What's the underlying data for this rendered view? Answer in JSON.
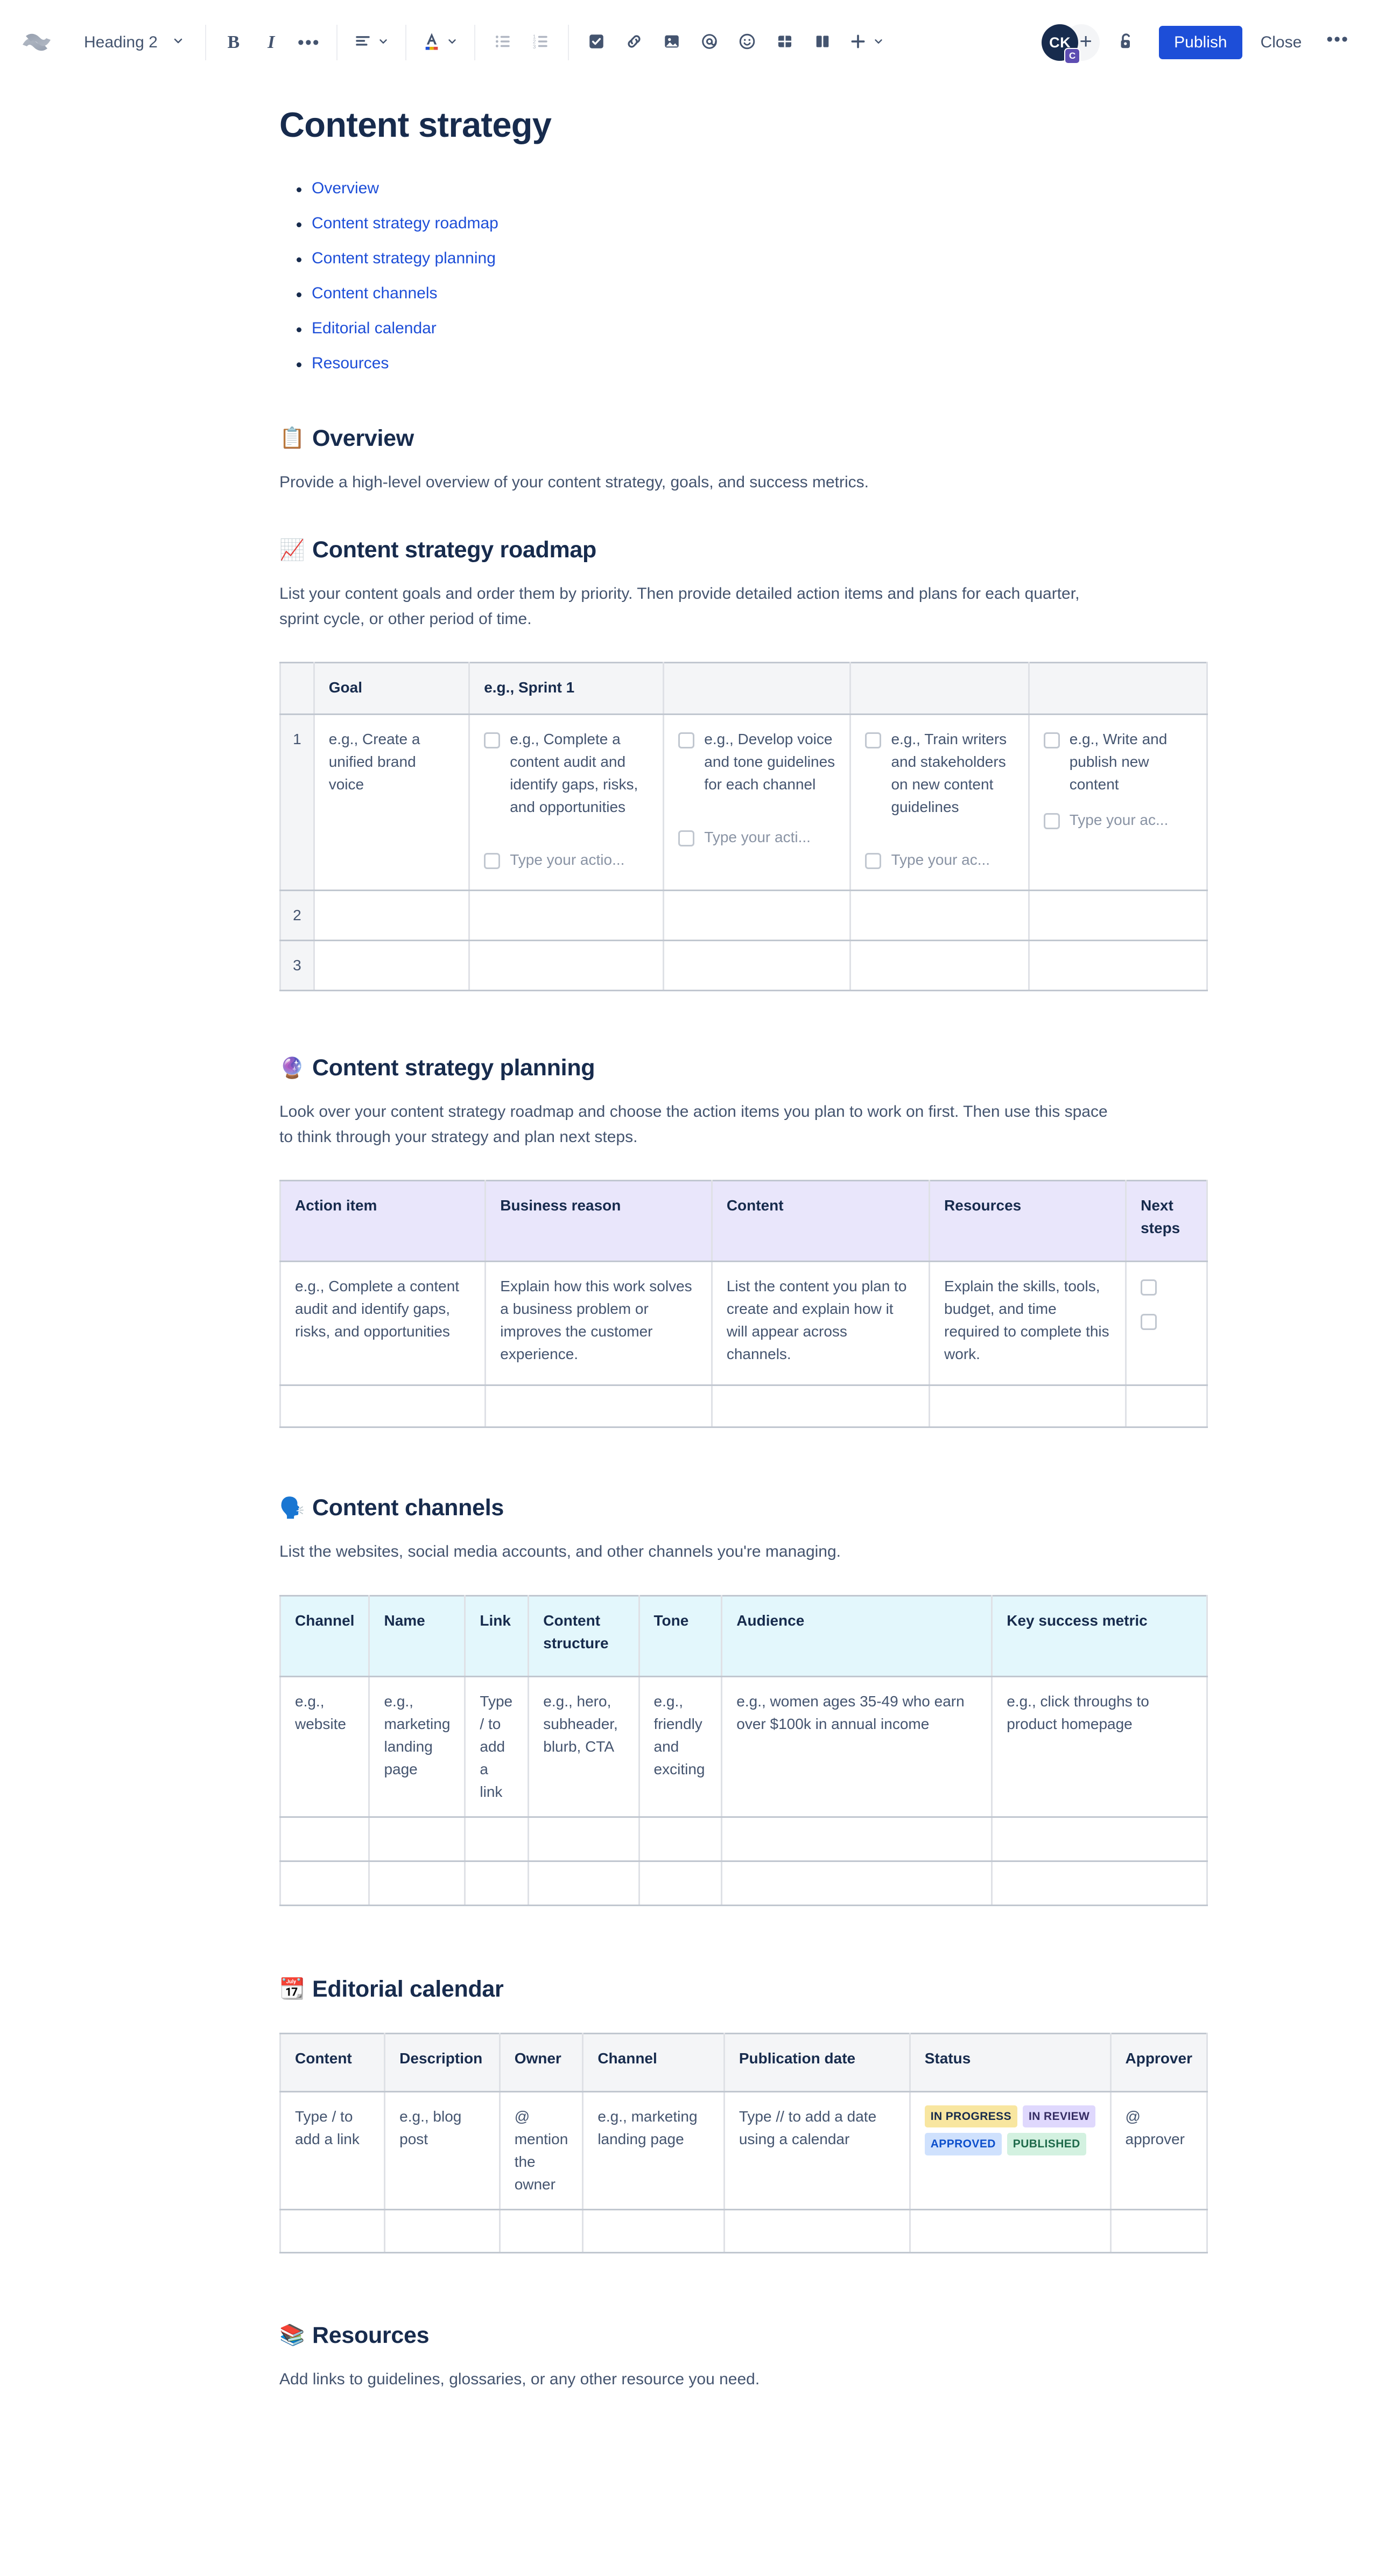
{
  "toolbar": {
    "logo_name": "confluence-logo",
    "style_select": {
      "label": "Heading 2"
    },
    "bold_label": "B",
    "italic_label": "I",
    "more_formatting_label": "•••",
    "avatar_initials": "CK",
    "avatar_badge": "C",
    "add_person_label": "+",
    "publish_label": "Publish",
    "close_label": "Close",
    "more_label": "•••",
    "accent_color": "#1D4ED8",
    "icons": [
      "text-style-dropdown",
      "bold-icon",
      "italic-icon",
      "more-formatting-icon",
      "text-align-icon",
      "text-color-icon",
      "bullet-list-icon",
      "numbered-list-icon",
      "task-list-icon",
      "link-icon",
      "image-icon",
      "mention-icon",
      "emoji-icon",
      "table-icon",
      "layout-icon",
      "insert-plus-icon",
      "lock-icon"
    ]
  },
  "document": {
    "title": "Content strategy",
    "toc": [
      {
        "label": "Overview"
      },
      {
        "label": "Content strategy roadmap"
      },
      {
        "label": "Content strategy planning"
      },
      {
        "label": "Content channels"
      },
      {
        "label": "Editorial calendar"
      },
      {
        "label": "Resources"
      }
    ],
    "sections": {
      "overview": {
        "emoji": "📋",
        "emoji_name": "clipboard-emoji",
        "heading": "Overview",
        "body": "Provide a high-level overview of your content strategy, goals, and success metrics."
      },
      "roadmap": {
        "emoji": "📈",
        "emoji_name": "chart-increasing-emoji",
        "heading": "Content strategy roadmap",
        "body": "List your content goals and order them by priority. Then provide detailed action items and plans for each quarter, sprint cycle, or other period of time.",
        "table": {
          "headers": [
            "",
            "Goal",
            "e.g., Sprint 1",
            "",
            "",
            ""
          ],
          "rows": [
            {
              "num": "1",
              "goal": "e.g., Create a unified brand voice",
              "cells": [
                {
                  "items": [
                    "e.g., Complete a content audit and identify gaps, risks, and opportunities"
                  ],
                  "placeholder": "Type your actio..."
                },
                {
                  "items": [
                    "e.g., Develop voice and tone guidelines for each channel"
                  ],
                  "placeholder": "Type your acti..."
                },
                {
                  "items": [
                    "e.g., Train writers and stakeholders on new content guidelines"
                  ],
                  "placeholder": "Type your ac..."
                },
                {
                  "items": [
                    "e.g., Write and publish new content"
                  ],
                  "placeholder": "Type your ac..."
                }
              ]
            },
            {
              "num": "2",
              "goal": "",
              "cells": [
                {},
                {},
                {},
                {}
              ]
            },
            {
              "num": "3",
              "goal": "",
              "cells": [
                {},
                {},
                {},
                {}
              ]
            }
          ]
        }
      },
      "planning": {
        "emoji": "🔮",
        "emoji_name": "crystal-ball-emoji",
        "heading": "Content strategy planning",
        "body": "Look over your content strategy roadmap and choose the action items you plan to work on first. Then use this space to think through your strategy and plan next steps.",
        "table": {
          "headers": [
            "Action item",
            "Business reason",
            "Content",
            "Resources",
            "Next steps"
          ],
          "rows": [
            {
              "action_item": "e.g., Complete a content audit and identify gaps, risks, and opportunities",
              "business_reason": "Explain how this work solves a business problem or improves the customer experience.",
              "content": "List the content you plan to create and explain how it will appear across channels.",
              "resources": "Explain the skills, tools, budget, and time required to complete this work.",
              "next_steps_checkboxes": 2
            },
            {
              "action_item": "",
              "business_reason": "",
              "content": "",
              "resources": "",
              "next_steps_checkboxes": 0
            }
          ]
        }
      },
      "channels": {
        "emoji": "🗣️",
        "emoji_name": "speaking-head-emoji",
        "heading": "Content channels",
        "body": "List the websites, social media accounts, and other channels you're managing.",
        "table": {
          "headers": [
            "Channel",
            "Name",
            "Link",
            "Content structure",
            "Tone",
            "Audience",
            "Key success metric"
          ],
          "rows": [
            [
              "e.g., website",
              "e.g., marketing landing page",
              "Type / to add a link",
              "e.g., hero, subheader, blurb, CTA",
              "e.g., friendly and exciting",
              "e.g., women ages 35-49 who earn over $100k in annual income",
              "e.g., click throughs to product homepage"
            ],
            [
              "",
              "",
              "",
              "",
              "",
              "",
              ""
            ],
            [
              "",
              "",
              "",
              "",
              "",
              "",
              ""
            ]
          ]
        }
      },
      "calendar": {
        "emoji": "📆",
        "emoji_name": "tear-off-calendar-emoji",
        "heading": "Editorial calendar",
        "table": {
          "headers": [
            "Content",
            "Description",
            "Owner",
            "Channel",
            "Publication date",
            "Status",
            "Approver"
          ],
          "rows": [
            {
              "content": "Type / to add a link",
              "description": "e.g., blog post",
              "owner": "@ mention the owner",
              "channel": "e.g., marketing landing page",
              "publication_date": "Type // to add a date using a calendar",
              "status": [
                {
                  "label": "IN PROGRESS",
                  "color": "#F8E6A0"
                },
                {
                  "label": "IN REVIEW",
                  "color": "#DFD8FD"
                },
                {
                  "label": "APPROVED",
                  "color": "#CFE1FD"
                },
                {
                  "label": "PUBLISHED",
                  "color": "#D3F1E0"
                }
              ],
              "approver": "@ approver"
            },
            {
              "content": "",
              "description": "",
              "owner": "",
              "channel": "",
              "publication_date": "",
              "status": [],
              "approver": ""
            }
          ]
        }
      },
      "resources": {
        "emoji": "📚",
        "emoji_name": "books-emoji",
        "heading": "Resources",
        "body": "Add links to guidelines, glossaries, or any other resource you need."
      }
    }
  }
}
